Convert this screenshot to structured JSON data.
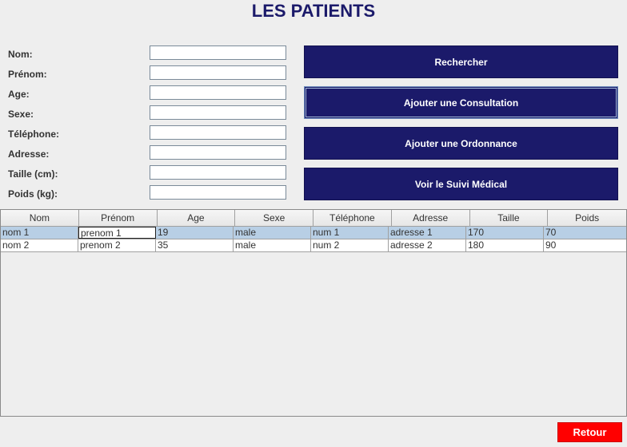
{
  "title": "LES PATIENTS",
  "form": {
    "labels": {
      "nom": "Nom:",
      "prenom": "Prénom:",
      "age": "Age:",
      "sexe": "Sexe:",
      "telephone": "Téléphone:",
      "adresse": "Adresse:",
      "taille": "Taille (cm):",
      "poids": "Poids (kg):"
    },
    "values": {
      "nom": "",
      "prenom": "",
      "age": "",
      "sexe": "",
      "telephone": "",
      "adresse": "",
      "taille": "",
      "poids": ""
    }
  },
  "buttons": {
    "rechercher": "Rechercher",
    "ajouter_consultation": "Ajouter une Consultation",
    "ajouter_ordonnance": "Ajouter une Ordonnance",
    "voir_suivi": "Voir le Suivi Médical",
    "retour": "Retour"
  },
  "table": {
    "columns": [
      "Nom",
      "Prénom",
      "Age",
      "Sexe",
      "Téléphone",
      "Adresse",
      "Taille",
      "Poids"
    ],
    "rows": [
      [
        "nom 1",
        "prenom 1",
        "19",
        "male",
        "num 1",
        "adresse 1",
        "170",
        "70"
      ],
      [
        "nom 2",
        "prenom 2",
        "35",
        "male",
        "num 2",
        "adresse 2",
        "180",
        "90"
      ]
    ],
    "selected_row": 0
  },
  "colors": {
    "primary": "#1b1a6a",
    "danger": "#ff0000",
    "selection": "#b8cfe5"
  }
}
